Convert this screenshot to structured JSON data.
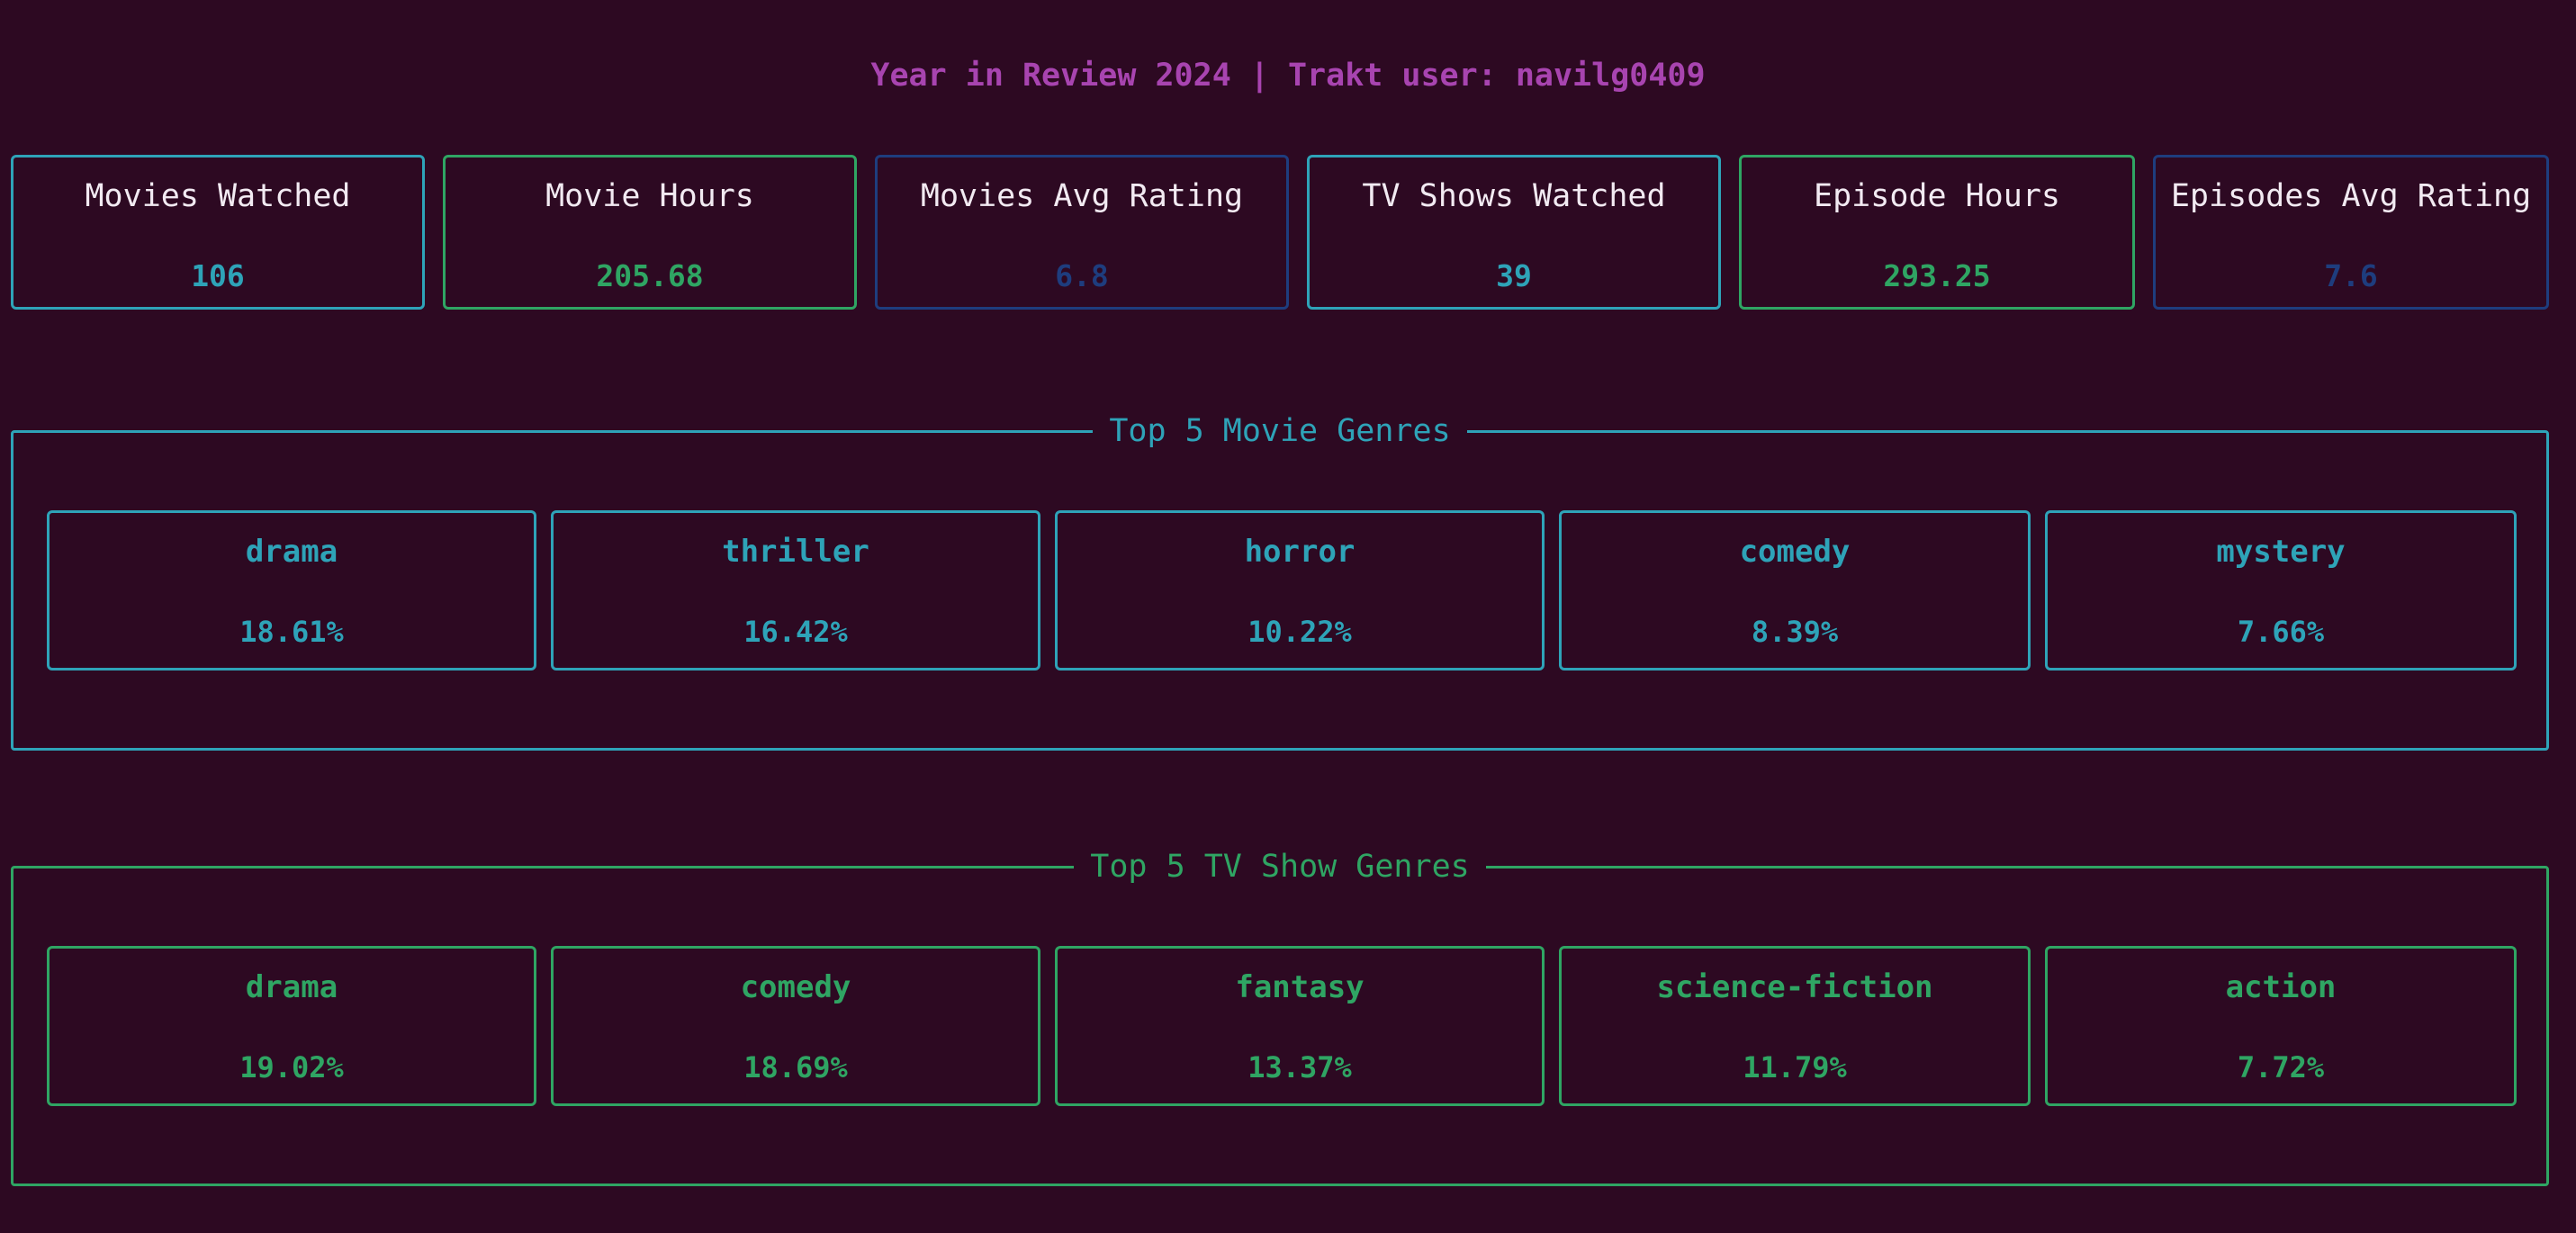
{
  "header": {
    "title": "Year in Review 2024 | Trakt user: navilg0409"
  },
  "stats": [
    {
      "label": "Movies Watched",
      "value": "106",
      "color": "#2ea3b8"
    },
    {
      "label": "Movie Hours",
      "value": "205.68",
      "color": "#2fa563"
    },
    {
      "label": "Movies Avg Rating",
      "value": "6.8",
      "color": "#1e3d7e"
    },
    {
      "label": "TV Shows Watched",
      "value": "39",
      "color": "#2ea3b8"
    },
    {
      "label": "Episode Hours",
      "value": "293.25",
      "color": "#2fa563"
    },
    {
      "label": "Episodes Avg Rating",
      "value": "7.6",
      "color": "#1e3d7e"
    }
  ],
  "movie_genres": {
    "title": "Top 5 Movie Genres",
    "color": "#2ea3b8",
    "items": [
      {
        "name": "drama",
        "percent": "18.61%"
      },
      {
        "name": "thriller",
        "percent": "16.42%"
      },
      {
        "name": "horror",
        "percent": "10.22%"
      },
      {
        "name": "comedy",
        "percent": "8.39%"
      },
      {
        "name": "mystery",
        "percent": "7.66%"
      }
    ]
  },
  "tv_genres": {
    "title": "Top 5 TV Show Genres",
    "color": "#2fa563",
    "items": [
      {
        "name": "drama",
        "percent": "19.02%"
      },
      {
        "name": "comedy",
        "percent": "18.69%"
      },
      {
        "name": "fantasy",
        "percent": "13.37%"
      },
      {
        "name": "science-fiction",
        "percent": "11.79%"
      },
      {
        "name": "action",
        "percent": "7.72%"
      }
    ]
  }
}
